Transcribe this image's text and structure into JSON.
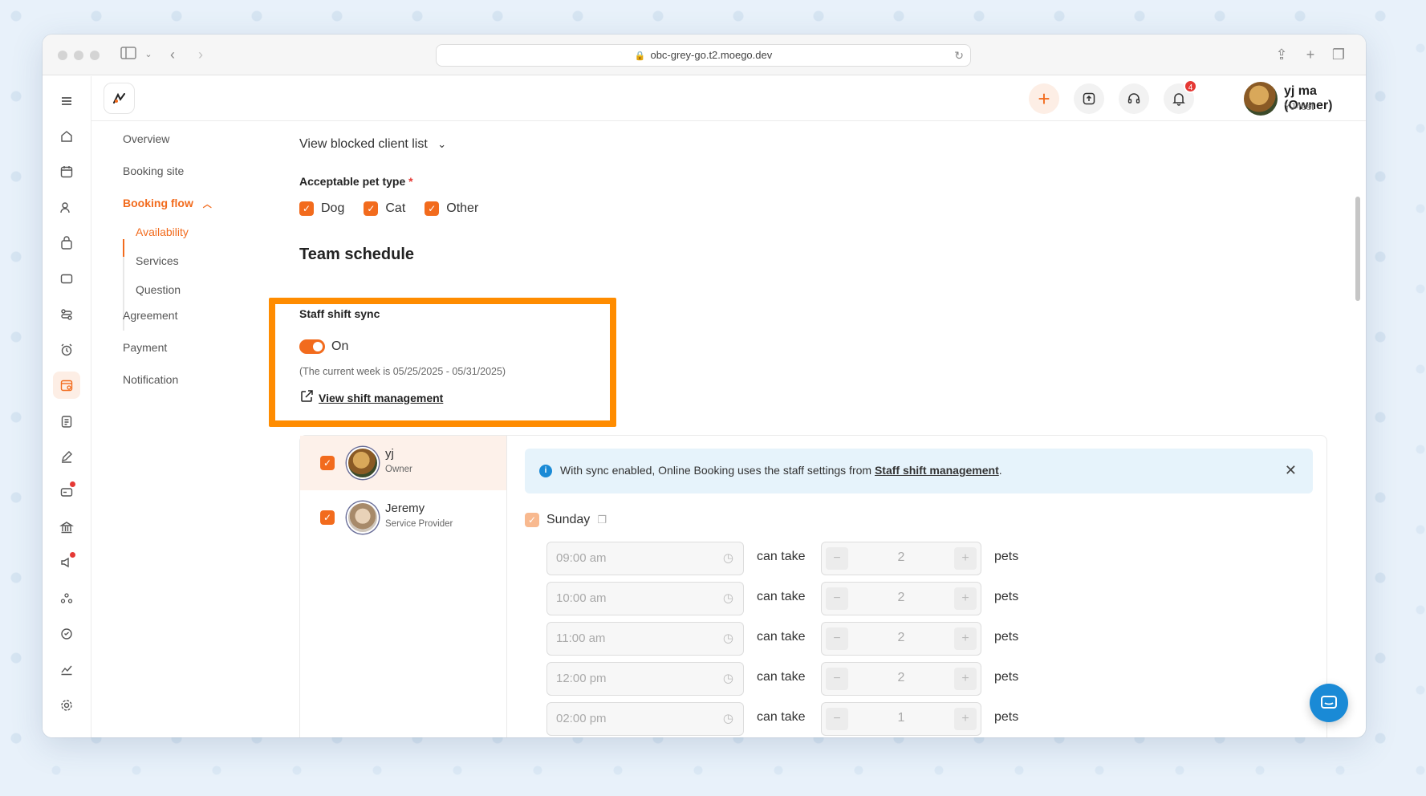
{
  "browser": {
    "url": "obc-grey-go.t2.moego.dev"
  },
  "topbar": {
    "notification_count": "4",
    "user_name": "yj ma (Owner)",
    "user_business": "YJ-test"
  },
  "subnav": {
    "overview": "Overview",
    "booking_site": "Booking site",
    "booking_flow": "Booking flow",
    "availability": "Availability",
    "services": "Services",
    "question": "Question",
    "agreement": "Agreement",
    "payment": "Payment",
    "notification": "Notification"
  },
  "main": {
    "blocked_link": "View blocked client list",
    "pet_type_label": "Acceptable pet type",
    "pet_types": [
      "Dog",
      "Cat",
      "Other"
    ],
    "team_schedule_title": "Team schedule",
    "sync_title": "Staff shift sync",
    "sync_state": "On",
    "week_note": "(The current week is 05/25/2025 - 05/31/2025)",
    "shift_link": "View shift management"
  },
  "staff": [
    {
      "name": "yj",
      "role": "Owner"
    },
    {
      "name": "Jeremy",
      "role": "Service Provider"
    }
  ],
  "info": {
    "message": "With sync enabled, Online Booking uses the staff settings from ",
    "link": "Staff shift management",
    "suffix": "."
  },
  "schedule": {
    "day": "Sunday",
    "can_take_label": "can take",
    "pets_label": "pets",
    "slots": [
      {
        "time": "09:00 am",
        "count": "2"
      },
      {
        "time": "10:00 am",
        "count": "2"
      },
      {
        "time": "11:00 am",
        "count": "2"
      },
      {
        "time": "12:00 pm",
        "count": "2"
      },
      {
        "time": "02:00 pm",
        "count": "1"
      }
    ]
  },
  "colors": {
    "accent": "#f26b1d",
    "highlight": "#ff8c00",
    "info_bg": "#e6f3fb"
  }
}
